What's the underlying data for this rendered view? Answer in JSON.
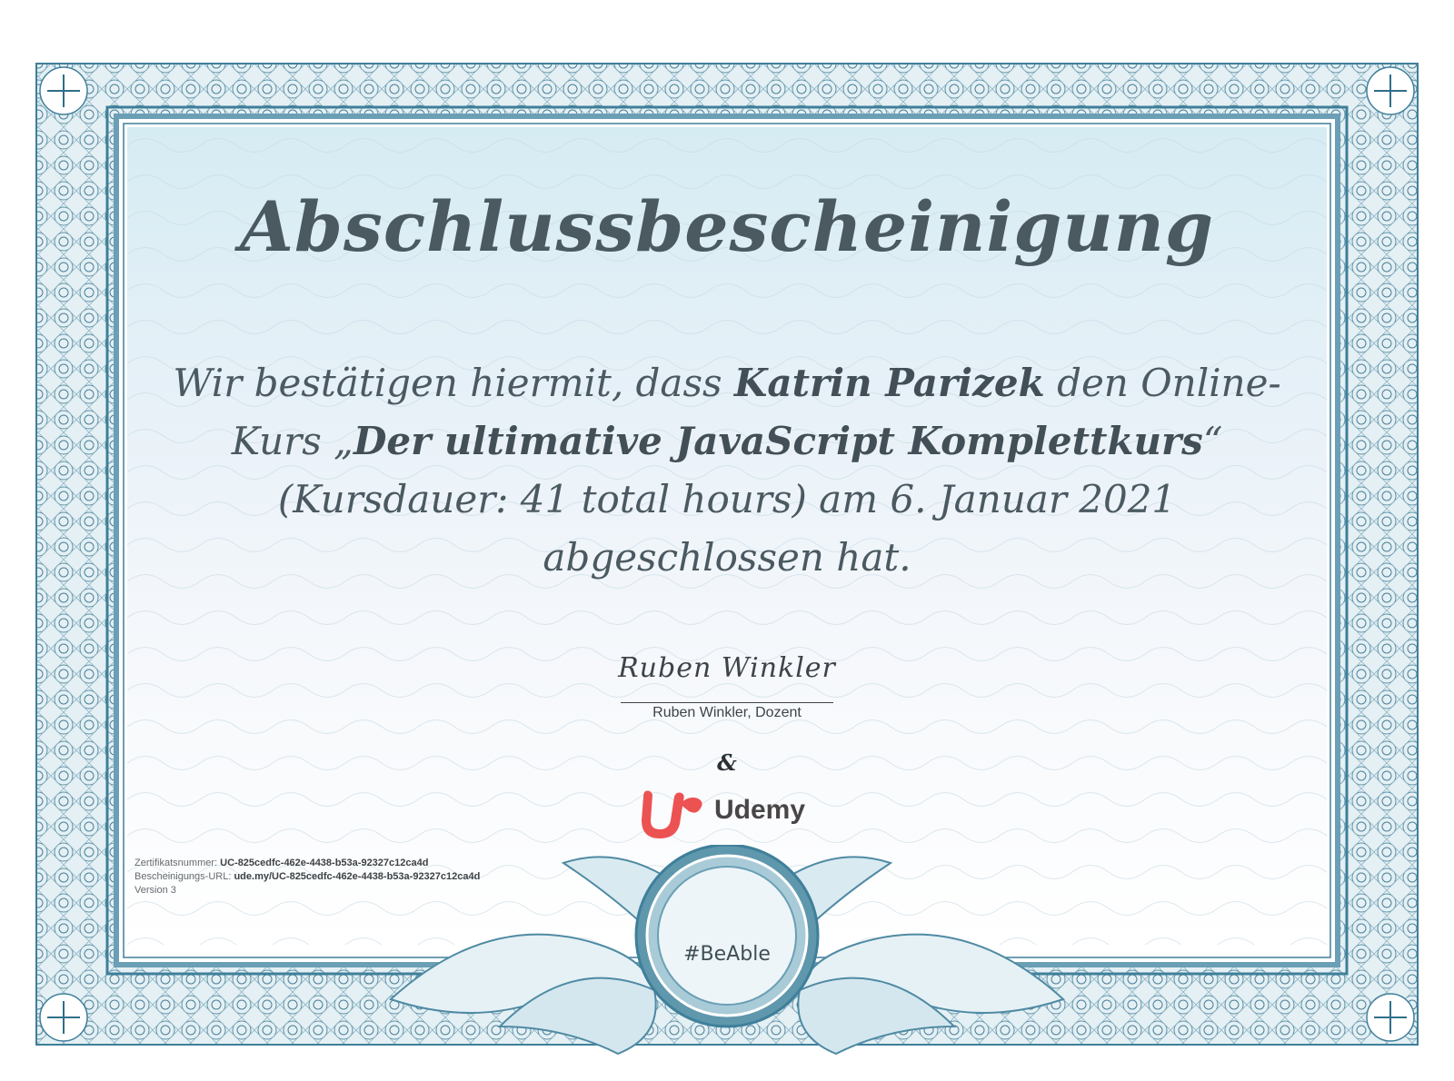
{
  "certificate": {
    "title": "Abschlussbescheinigung",
    "statement": {
      "intro": "Wir bestätigen hiermit, dass ",
      "student_name": "Katrin Parizek",
      "middle": " den Online-Kurs „",
      "course_title": "Der ultimative JavaScript Komplettkurs",
      "outro": "“ (Kursdauer: 41 total hours) am 6. Januar 2021 abgeschlossen hat."
    },
    "signature": {
      "handwritten": "Ruben Winkler",
      "caption": "Ruben Winkler, Dozent"
    },
    "ampersand": "&",
    "issuer": {
      "name": "Udemy",
      "logo_color": "#ec5252"
    },
    "meta": {
      "number_label": "Zertifikatsnummer: ",
      "number_value": "UC-825cedfc-462e-4438-b53a-92327c12ca4d",
      "url_label": "Bescheinigungs-URL: ",
      "url_value": "ude.my/UC-825cedfc-462e-4438-b53a-92327c12ca4d",
      "version": "Version 3"
    },
    "seal": {
      "text": "#BeAble"
    },
    "colors": {
      "border": "#3f7f9a",
      "text": "#4b5961"
    }
  }
}
